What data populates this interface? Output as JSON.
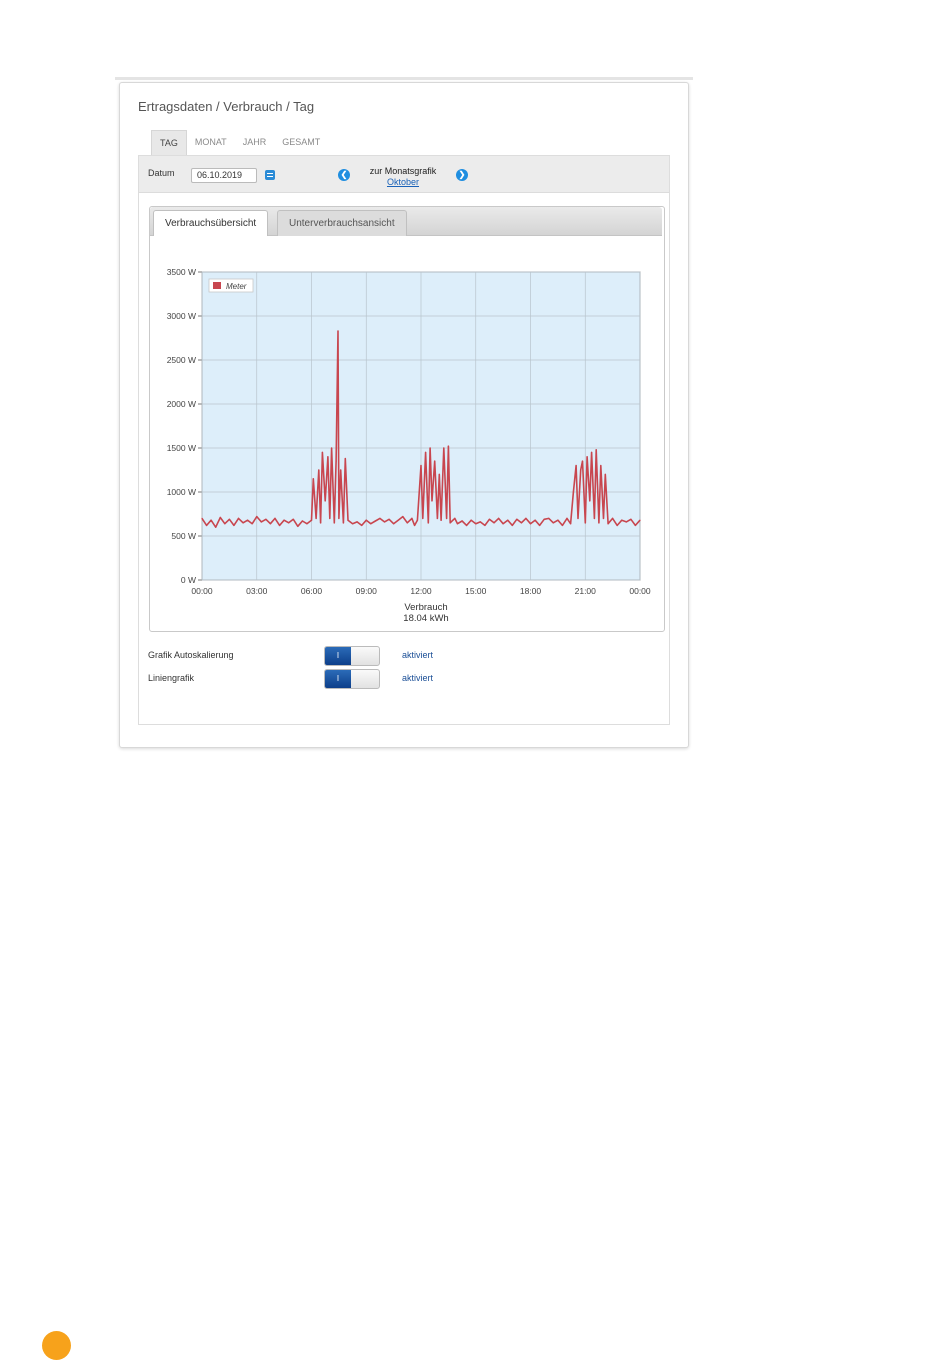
{
  "page": {
    "title": "Ertragsdaten / Verbrauch / Tag"
  },
  "tabs": [
    {
      "label": "TAG",
      "active": true
    },
    {
      "label": "MONAT",
      "active": false
    },
    {
      "label": "JAHR",
      "active": false
    },
    {
      "label": "GESAMT",
      "active": false
    }
  ],
  "datebar": {
    "date_label": "Datum",
    "date_value": "06.10.2019",
    "nav_label": "zur Monatsgrafik",
    "nav_link": "Oktober",
    "prev_icon": "chevron-left",
    "next_icon": "chevron-right"
  },
  "subtabs": [
    {
      "label": "Verbrauchsübersicht",
      "active": true
    },
    {
      "label": "Unterverbrauchsansicht",
      "active": false
    }
  ],
  "settings": [
    {
      "label": "Grafik Autoskalierung",
      "toggle_text": "I",
      "state": "aktiviert"
    },
    {
      "label": "Liniengrafik",
      "toggle_text": "I",
      "state": "aktiviert"
    }
  ],
  "colors": {
    "accent": "#1f8ee0",
    "series": "#c8464f",
    "plot_bg": "#ddeefa",
    "page_marker": "#f7a21b"
  },
  "chart_data": {
    "type": "line",
    "xlabel": "",
    "ylabel": "",
    "summary_label": "Verbrauch",
    "summary_value": "18.04 kWh",
    "x_ticks": [
      "00:00",
      "03:00",
      "06:00",
      "09:00",
      "12:00",
      "15:00",
      "18:00",
      "21:00",
      "00:00"
    ],
    "y_ticks": [
      "0 W",
      "500 W",
      "1000 W",
      "1500 W",
      "2000 W",
      "2500 W",
      "3000 W",
      "3500 W"
    ],
    "ylim": [
      0,
      3500
    ],
    "xlim_hours": [
      0,
      24
    ],
    "grid": true,
    "legend_position": "top-left",
    "series": [
      {
        "name": "Meter",
        "x_hours": [
          0.0,
          0.25,
          0.5,
          0.75,
          1.0,
          1.25,
          1.5,
          1.75,
          2.0,
          2.25,
          2.5,
          2.75,
          3.0,
          3.25,
          3.5,
          3.75,
          4.0,
          4.25,
          4.5,
          4.75,
          5.0,
          5.25,
          5.5,
          5.75,
          6.0,
          6.1,
          6.25,
          6.4,
          6.5,
          6.6,
          6.75,
          6.9,
          7.0,
          7.1,
          7.25,
          7.35,
          7.45,
          7.5,
          7.6,
          7.75,
          7.85,
          8.0,
          8.25,
          8.5,
          8.75,
          9.0,
          9.25,
          9.5,
          9.75,
          10.0,
          10.25,
          10.5,
          10.75,
          11.0,
          11.25,
          11.5,
          11.65,
          11.8,
          12.0,
          12.1,
          12.25,
          12.4,
          12.5,
          12.6,
          12.75,
          12.9,
          13.0,
          13.1,
          13.25,
          13.4,
          13.5,
          13.6,
          13.75,
          13.85,
          14.0,
          14.25,
          14.5,
          14.75,
          15.0,
          15.25,
          15.5,
          15.75,
          16.0,
          16.25,
          16.5,
          16.75,
          17.0,
          17.25,
          17.5,
          17.75,
          18.0,
          18.25,
          18.5,
          18.75,
          19.0,
          19.25,
          19.5,
          19.75,
          20.0,
          20.2,
          20.35,
          20.5,
          20.6,
          20.75,
          20.85,
          21.0,
          21.1,
          21.25,
          21.35,
          21.5,
          21.6,
          21.75,
          21.85,
          22.0,
          22.1,
          22.25,
          22.5,
          22.75,
          23.0,
          23.25,
          23.5,
          23.75,
          24.0
        ],
        "values": [
          700,
          620,
          680,
          600,
          710,
          640,
          690,
          620,
          700,
          650,
          680,
          640,
          720,
          660,
          690,
          640,
          700,
          620,
          680,
          650,
          690,
          610,
          670,
          640,
          680,
          1150,
          700,
          1250,
          650,
          1450,
          900,
          1400,
          700,
          1500,
          650,
          1350,
          2830,
          700,
          1250,
          650,
          1380,
          680,
          640,
          660,
          620,
          680,
          640,
          670,
          700,
          660,
          690,
          640,
          680,
          720,
          650,
          700,
          620,
          680,
          1300,
          700,
          1450,
          650,
          1500,
          900,
          1350,
          700,
          1200,
          680,
          1500,
          700,
          1520,
          650,
          680,
          700,
          640,
          670,
          620,
          680,
          640,
          660,
          620,
          690,
          650,
          700,
          640,
          680,
          620,
          690,
          650,
          700,
          640,
          680,
          620,
          690,
          700,
          650,
          680,
          620,
          700,
          640,
          1000,
          1300,
          700,
          1250,
          1350,
          650,
          1400,
          900,
          1450,
          700,
          1480,
          650,
          1300,
          700,
          1200,
          640,
          700,
          620,
          680,
          660,
          690,
          620,
          680,
          640,
          660
        ]
      }
    ]
  }
}
